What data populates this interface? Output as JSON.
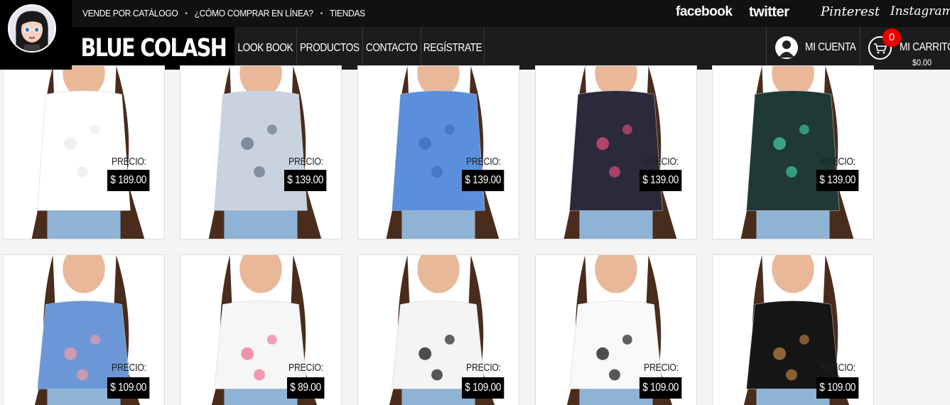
{
  "top_links": [
    "VENDE POR CATÁLOGO",
    "¿CÓMO COMPRAR EN LÍNEA?",
    "TIENDAS"
  ],
  "social": {
    "facebook": "facebook",
    "twitter": "twitter",
    "pinterest": "Pinterest",
    "instagram": "Instagram"
  },
  "brand": "BLUE COLASH",
  "nav": [
    "LOOK BOOK",
    "PRODUCTOS",
    "CONTACTO",
    "REGÍSTRATE"
  ],
  "account": {
    "label": "MI CUENTA"
  },
  "cart": {
    "label": "MI CARRITO",
    "count": "0",
    "total": "$0.00"
  },
  "price_label": "PRECIO:",
  "products": [
    {
      "price": "$ 189.00",
      "colors": [
        "#ffffff",
        "#ececec"
      ]
    },
    {
      "price": "$ 139.00",
      "colors": [
        "#c9d3df",
        "#6b7a8a"
      ]
    },
    {
      "price": "$ 139.00",
      "colors": [
        "#5b8fdc",
        "#3c6fc0"
      ]
    },
    {
      "price": "$ 139.00",
      "colors": [
        "#2a2a3a",
        "#d44a7a"
      ]
    },
    {
      "price": "$ 139.00",
      "colors": [
        "#1f3a36",
        "#3fbf9a"
      ]
    },
    {
      "price": "$ 109.00",
      "colors": [
        "#6c97d6",
        "#e89aa8"
      ]
    },
    {
      "price": "$ 89.00",
      "colors": [
        "#f6f6f6",
        "#f07a9a"
      ]
    },
    {
      "price": "$ 109.00",
      "colors": [
        "#f4f4f4",
        "#222222"
      ]
    },
    {
      "price": "$ 109.00",
      "colors": [
        "#f8f8f8",
        "#222222"
      ]
    },
    {
      "price": "$ 109.00",
      "colors": [
        "#161616",
        "#b07840"
      ]
    }
  ],
  "accent": {
    "badge": "#ee0000",
    "header": "#1c1c1c"
  }
}
